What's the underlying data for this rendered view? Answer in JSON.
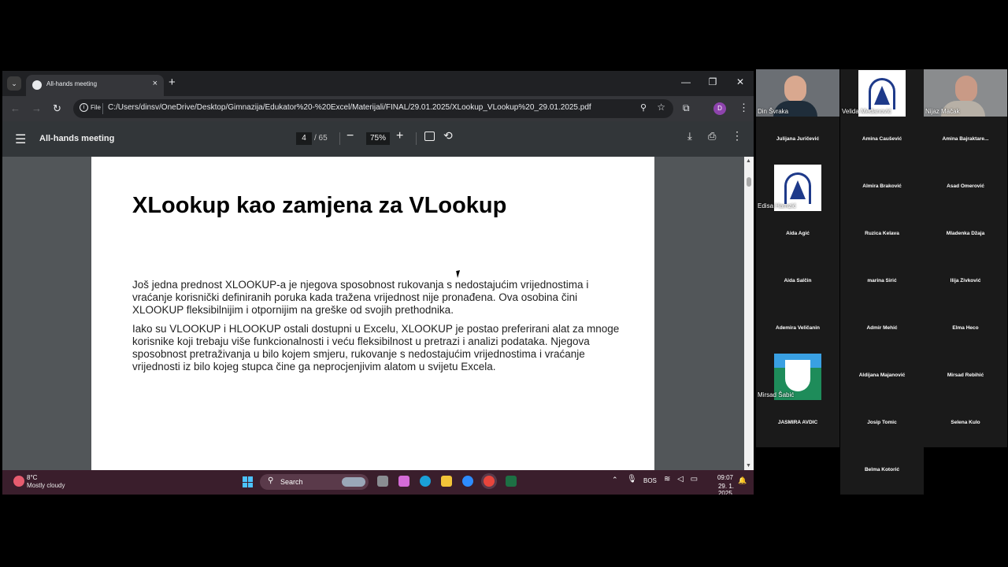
{
  "browser": {
    "tab_title": "All-hands meeting",
    "tab_close": "×",
    "new_tab": "+",
    "tab_list": "⌄",
    "window_controls": {
      "minimize": "—",
      "restore": "❐",
      "close": "✕"
    },
    "nav": {
      "back": "←",
      "forward": "→",
      "reload": "↻"
    },
    "omnibox": {
      "info_icon": "i",
      "chip": "File",
      "url": "C:/Users/dinsv/OneDrive/Desktop/Gimnazija/Edukator%20-%20Excel/Materijali/FINAL/29.01.2025/XLookup_VLookup%20_29.01.2025.pdf",
      "zoom_icon": "⚲",
      "star_icon": "☆"
    },
    "extensions_icon": "⧉",
    "profile_initial": "D",
    "menu_icon": "⋮"
  },
  "pdf_viewer": {
    "menu_icon": "☰",
    "title": "All-hands meeting",
    "page_current": "4",
    "page_total": "/ 65",
    "zoom_out": "−",
    "zoom": "75%",
    "zoom_in": "+",
    "rotate_icon": "⟲",
    "download_icon": "⤓",
    "print_icon": "⎙",
    "more_icon": "⋮"
  },
  "slide": {
    "title": "XLookup kao zamjena za VLookup",
    "paragraph1": "Još jedna prednost XLOOKUP-a je njegova sposobnost rukovanja s nedostajućim vrijednostima i vraćanje korisnički definiranih poruka kada tražena vrijednost nije pronađena. Ova osobina čini XLOOKUP fleksibilnijim i otpornijim na greške od svojih prethodnika.",
    "paragraph2": "Iako su VLOOKUP i HLOOKUP ostali dostupni u Excelu, XLOOKUP je postao preferirani alat za mnoge korisnike koji trebaju više funkcionalnosti i veću fleksibilnost u pretrazi i analizi podataka. Njegova sposobnost pretraživanja u bilo kojem smjeru, rukovanje s nedostajućim vrijednostima i vraćanje vrijednosti iz bilo kojeg stupca čine ga neprocjenjivim alatom u svijetu Excela."
  },
  "scrollbar": {
    "up": "▲",
    "down": "▼"
  },
  "taskbar": {
    "weather_temp": "8°C",
    "weather_desc": "Mostly cloudy",
    "search_label": "Search",
    "search_icon": "⚲",
    "systray_up": "⌃",
    "mic_icon": "🎙",
    "language": "BOS",
    "net_icons": "≋ ◁ ▭",
    "time": "09:07",
    "date": "29. 1. 2025.",
    "notification_icon": "🔔"
  },
  "participants": {
    "video_tiles": [
      {
        "name": "Din Švraka"
      },
      {
        "name": "Velida Međanović"
      },
      {
        "name": "Nijaz Mačak"
      },
      {
        "name": "Edisa Hamzić"
      },
      {
        "name": "Mirsad Šabić"
      }
    ],
    "name_tiles": [
      "Julijana Juričević",
      "Amina Čaušević",
      "Amina Bajraktare...",
      "Almira Braković",
      "Asad Omerović",
      "Aida Agić",
      "Ruzica Kelava",
      "Mladenka Džaja",
      "Aida Salčin",
      "marina Širić",
      "Ilija Živković",
      "Ademira Veličanin",
      "Admir Mehić",
      "Elma Heco",
      "Aldijana Majanović",
      "Mirsad Rebihić",
      "JASMIRA AVDIĆ",
      "Josip Tomic",
      "Selena Kulo",
      "Belma Kotorić"
    ]
  }
}
